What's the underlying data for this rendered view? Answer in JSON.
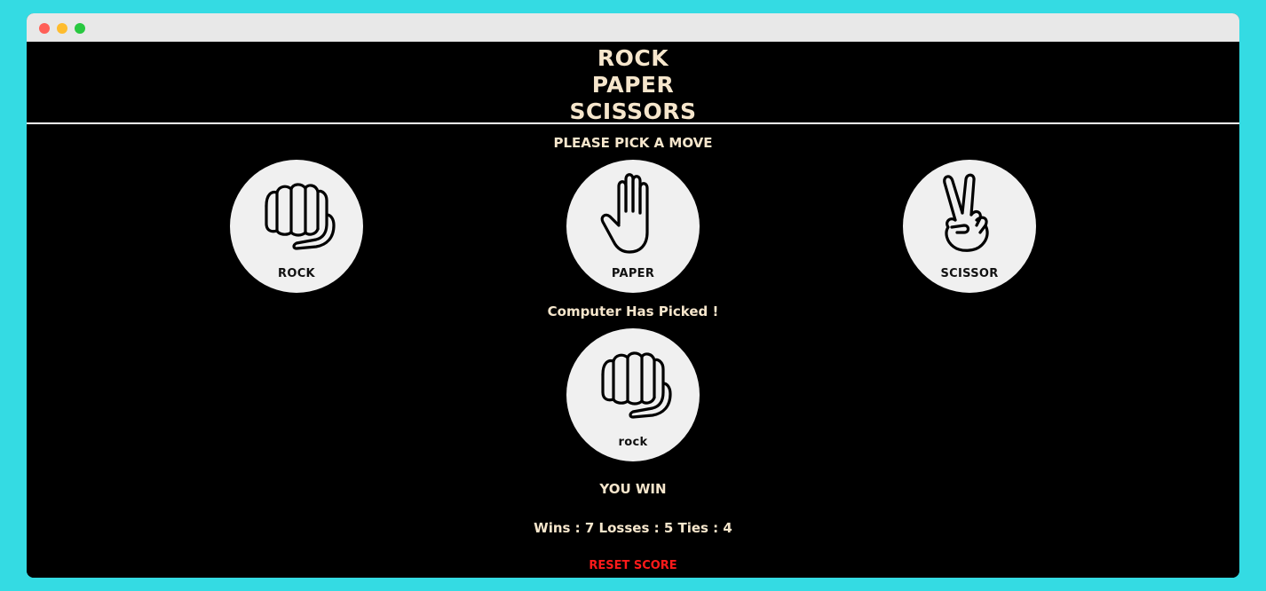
{
  "window": {
    "buttons": [
      "close",
      "minimize",
      "maximize"
    ]
  },
  "header": {
    "title_lines": [
      "ROCK",
      "PAPER",
      "SCISSORS"
    ]
  },
  "prompt": "PLEASE PICK A MOVE",
  "moves": [
    {
      "label": "ROCK",
      "icon": "fist-icon"
    },
    {
      "label": "PAPER",
      "icon": "open-hand-icon"
    },
    {
      "label": "SCISSOR",
      "icon": "peace-sign-icon"
    }
  ],
  "computer": {
    "heading": "Computer Has Picked !",
    "pick_label": "rock",
    "pick_icon": "fist-icon"
  },
  "result": "YOU WIN",
  "score": {
    "text": "Wins : 7 Losses : 5 Ties : 4",
    "wins": 7,
    "losses": 5,
    "ties": 4
  },
  "reset_label": "RESET SCORE",
  "colors": {
    "page_background": "#34dbe3",
    "app_background": "#000000",
    "text": "#f6e6cc",
    "circle": "#f0f0f0",
    "reset": "#ff1a1a"
  }
}
